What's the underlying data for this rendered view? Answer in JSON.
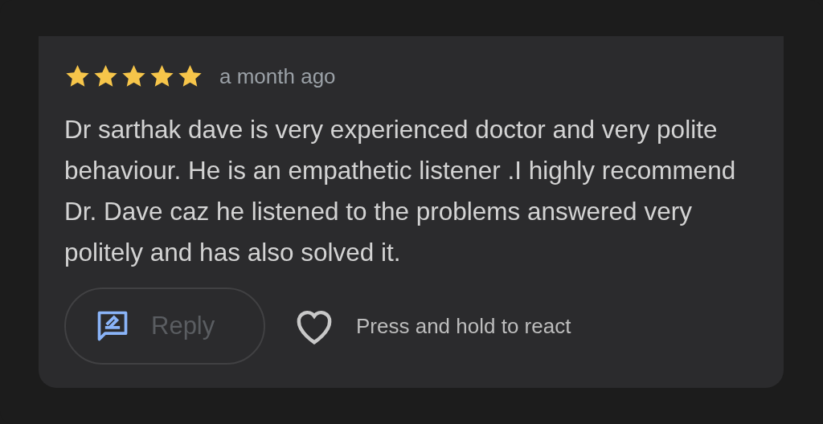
{
  "rating": {
    "stars": 5
  },
  "time": "a month ago",
  "review": "Dr sarthak dave is very experienced doctor and very polite behaviour. He is an empathetic listener .I highly recommend Dr. Dave caz he listened to the problems answered very politely and has also solved it.",
  "reply_button": {
    "label": "Reply",
    "disabled": true
  },
  "react": {
    "label": "Press and hold to react"
  }
}
